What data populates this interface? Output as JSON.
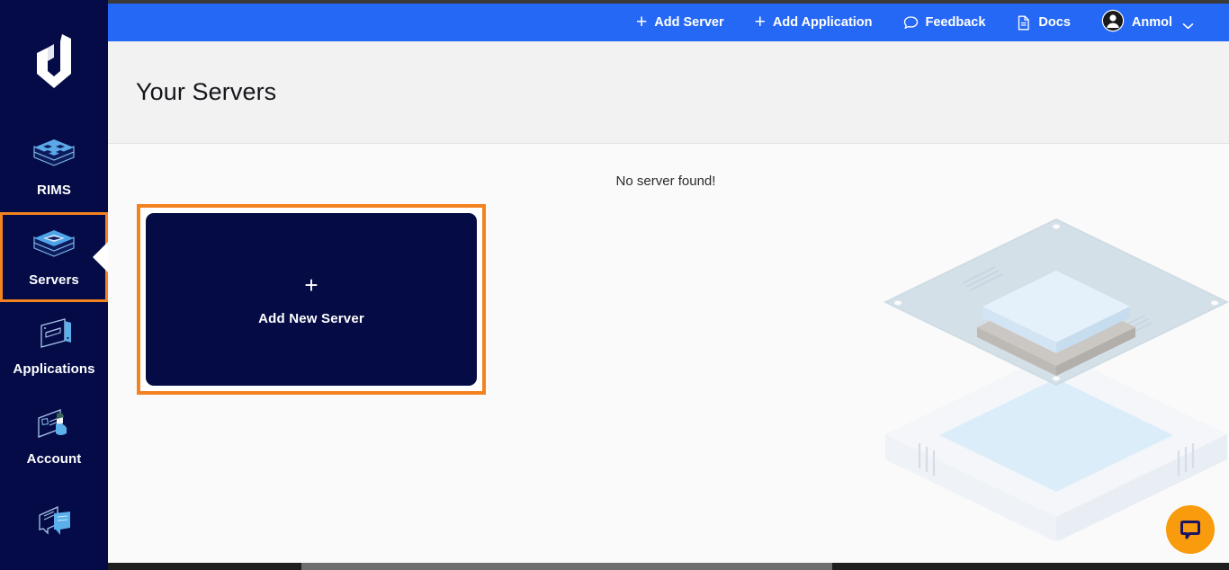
{
  "app": {
    "logo_name": "duplocloud-logo",
    "accent_blue": "#2668F6",
    "sidebar_navy": "#040B47",
    "highlight_orange": "#F58220",
    "chat_orange": "#F89B0C"
  },
  "sidebar": {
    "items": [
      {
        "label": "RIMS",
        "icon": "rims-stack-icon",
        "active": false
      },
      {
        "label": "Servers",
        "icon": "server-chip-icon",
        "active": true
      },
      {
        "label": "Applications",
        "icon": "applications-card-icon",
        "active": false
      },
      {
        "label": "Account",
        "icon": "account-user-card-icon",
        "active": false
      },
      {
        "label": "",
        "icon": "support-chat-icon",
        "active": false
      }
    ]
  },
  "topbar": {
    "items": [
      {
        "label": "Add Server",
        "icon": "plus-icon"
      },
      {
        "label": "Add Application",
        "icon": "plus-icon"
      },
      {
        "label": "Feedback",
        "icon": "speech-bubble-icon"
      },
      {
        "label": "Docs",
        "icon": "document-icon"
      }
    ],
    "user": {
      "name": "Anmol",
      "avatar_icon": "avatar-icon",
      "chevron_icon": "chevron-down-icon"
    }
  },
  "header": {
    "title": "Your Servers"
  },
  "main": {
    "empty_message": "No server found!",
    "add_card": {
      "plus": "+",
      "label": "Add New Server"
    },
    "illustration_name": "isometric-server-chip-illustration"
  },
  "chat": {
    "icon": "chat-bubble-icon",
    "label": ""
  },
  "scrollbar": {
    "name": "horizontal-scrollbar"
  }
}
